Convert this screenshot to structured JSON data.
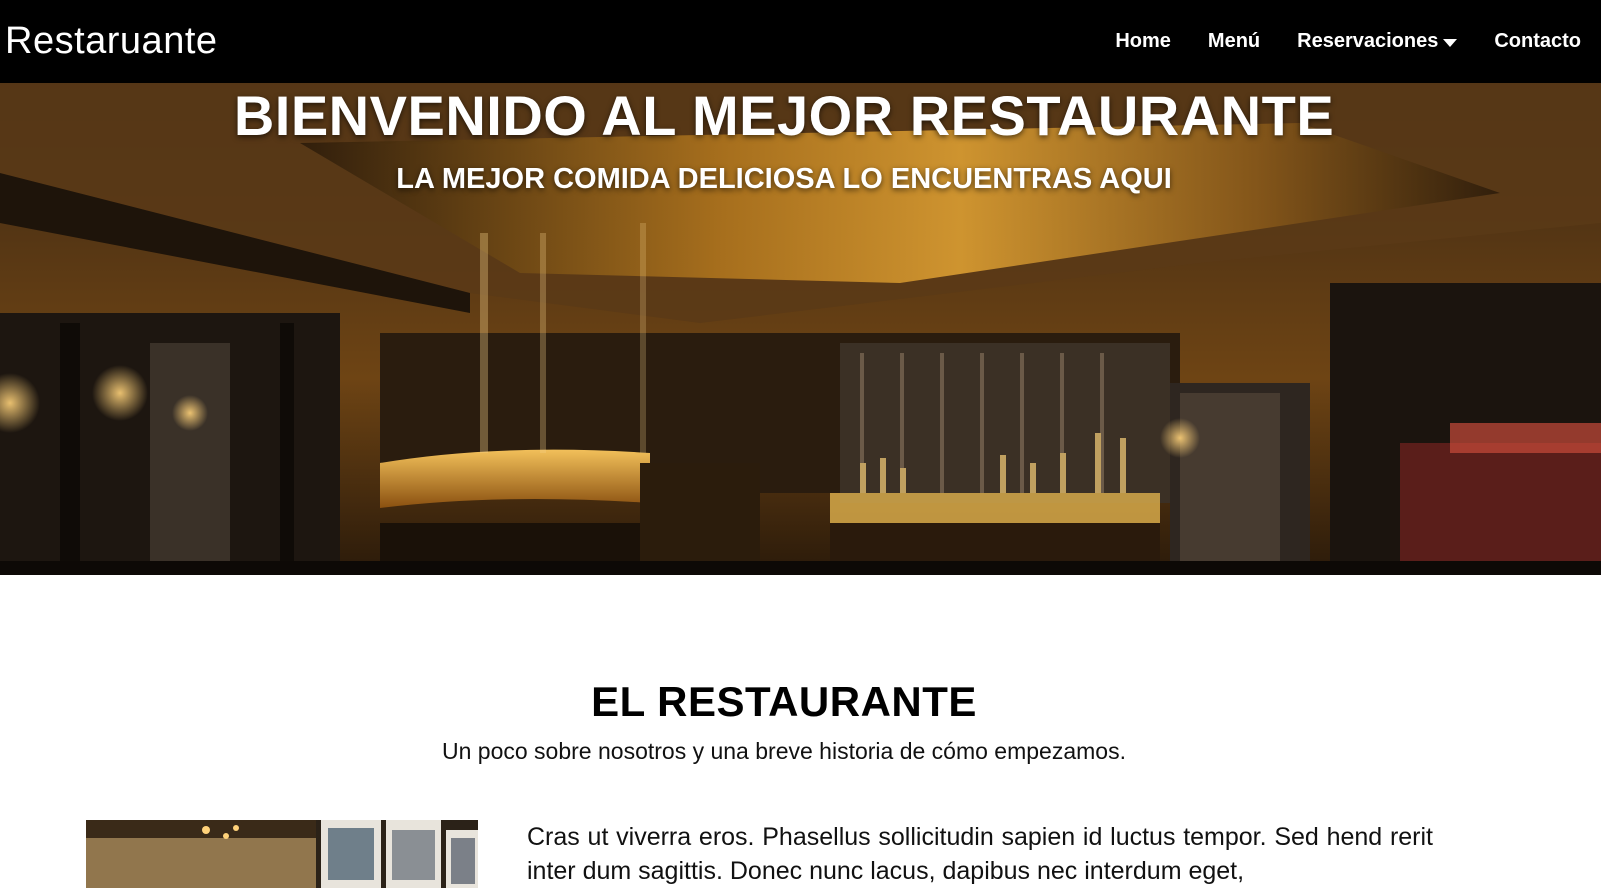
{
  "navbar": {
    "brand": "Restaruante",
    "links": [
      {
        "label": "Home"
      },
      {
        "label": "Menú"
      },
      {
        "label": "Reservaciones"
      },
      {
        "label": "Contacto"
      }
    ]
  },
  "hero": {
    "title": "BIENVENIDO AL MEJOR RESTAURANTE",
    "subtitle": "LA MEJOR COMIDA DELICIOSA LO ENCUENTRAS AQUI"
  },
  "about": {
    "title": "EL RESTAURANTE",
    "lead": "Un poco sobre nosotros y una breve historia de cómo empezamos.",
    "paragraph": "Cras ut viverra eros. Phasellus sollicitudin sapien id luctus tempor. Sed hend rerit inter dum sagittis. Donec nunc lacus, dapibus nec interdum eget,"
  },
  "colors": {
    "navbar_bg": "#000000",
    "text_light": "#ffffff",
    "text_dark": "#000000"
  }
}
